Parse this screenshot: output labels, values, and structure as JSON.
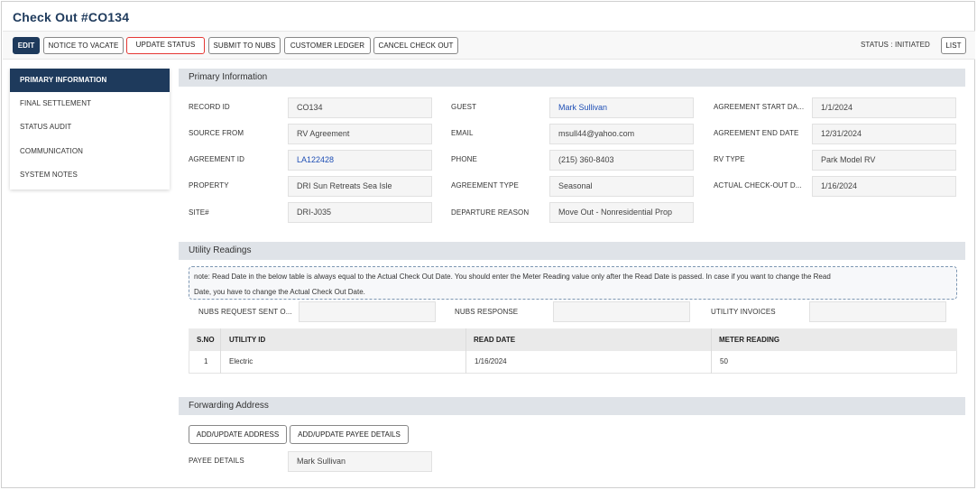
{
  "page": {
    "title": "Check Out #CO134"
  },
  "toolbar": {
    "edit": "EDIT",
    "notice_to_vacate": "NOTICE TO VACATE",
    "update_status": "UPDATE STATUS",
    "submit_to_nubs": "SUBMIT TO NUBS",
    "customer_ledger": "CUSTOMER LEDGER",
    "cancel_check_out": "CANCEL CHECK OUT",
    "status": "STATUS : INITIATED",
    "list": "LIST"
  },
  "sidebar": {
    "items": [
      {
        "label": "PRIMARY INFORMATION"
      },
      {
        "label": "FINAL SETTLEMENT"
      },
      {
        "label": "STATUS AUDIT"
      },
      {
        "label": "COMMUNICATION"
      },
      {
        "label": "SYSTEM NOTES"
      }
    ]
  },
  "primary": {
    "heading": "Primary Information",
    "record_id": {
      "label": "RECORD ID",
      "value": "CO134"
    },
    "source_from": {
      "label": "SOURCE FROM",
      "value": "RV Agreement"
    },
    "agreement_id": {
      "label": "AGREEMENT ID",
      "value": "LA122428"
    },
    "property": {
      "label": "PROPERTY",
      "value": "DRI Sun Retreats Sea Isle"
    },
    "site": {
      "label": "SITE#",
      "value": "DRI-J035"
    },
    "guest": {
      "label": "GUEST",
      "value": "Mark Sullivan"
    },
    "email": {
      "label": "EMAIL",
      "value": "msull44@yahoo.com"
    },
    "phone": {
      "label": "PHONE",
      "value": "(215) 360-8403"
    },
    "agreement_type": {
      "label": "AGREEMENT TYPE",
      "value": "Seasonal"
    },
    "departure_reason": {
      "label": "DEPARTURE REASON",
      "value": "Move Out - Nonresidential Prop"
    },
    "agreement_start": {
      "label": "AGREEMENT START DA...",
      "value": "1/1/2024"
    },
    "agreement_end": {
      "label": "AGREEMENT END DATE",
      "value": "12/31/2024"
    },
    "rv_type": {
      "label": "RV TYPE",
      "value": "Park Model RV"
    },
    "actual_checkout": {
      "label": "ACTUAL CHECK-OUT D...",
      "value": "1/16/2024"
    }
  },
  "utility": {
    "heading": "Utility Readings",
    "note_line1": "note: Read Date in the below table is always equal to the Actual Check Out Date. You should enter the Meter Reading value only after the Read Date is passed. In case if you want to change the Read",
    "note_line2": "Date, you have to change the Actual Check Out Date.",
    "nubs_request": {
      "label": "NUBS REQUEST SENT O...",
      "value": ""
    },
    "nubs_response": {
      "label": "NUBS RESPONSE",
      "value": ""
    },
    "utility_invoices": {
      "label": "UTILITY INVOICES",
      "value": ""
    },
    "columns": [
      "S.NO",
      "UTILITY ID",
      "READ DATE",
      "METER READING"
    ],
    "rows": [
      {
        "sno": "1",
        "utility_id": "Electric",
        "read_date": "1/16/2024",
        "meter_reading": "50"
      }
    ]
  },
  "forwarding": {
    "heading": "Forwarding Address",
    "add_address": "ADD/UPDATE ADDRESS",
    "add_payee": "ADD/UPDATE PAYEE DETAILS",
    "payee": {
      "label": "PAYEE DETAILS",
      "value": "Mark Sullivan"
    }
  },
  "colors": {
    "primary_dark": "#1e3a5c",
    "section_header": "#dfe3e8",
    "link": "#1f4fb5",
    "highlight_border": "#e53935"
  }
}
